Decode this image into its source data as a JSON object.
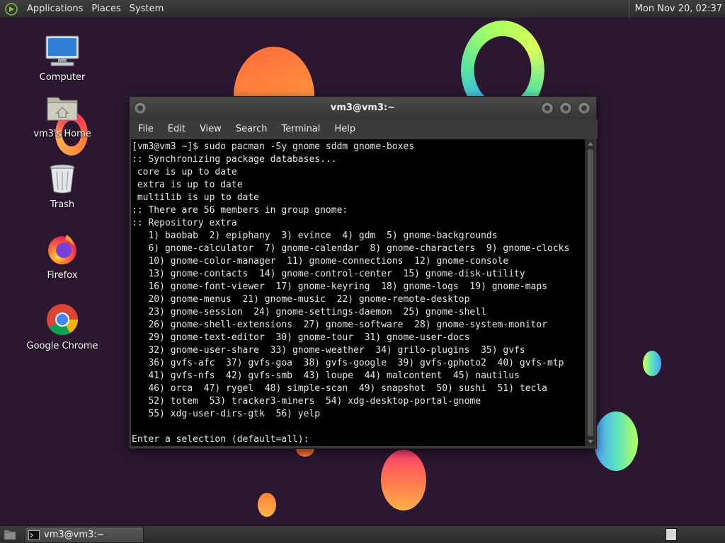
{
  "top_panel": {
    "menus": [
      "Applications",
      "Places",
      "System"
    ],
    "clock": "Mon Nov 20, 02:37"
  },
  "desktop_icons": [
    {
      "label": "Computer",
      "icon": "computer-icon"
    },
    {
      "label": "vm3's Home",
      "icon": "home-folder-icon"
    },
    {
      "label": "Trash",
      "icon": "trash-icon"
    },
    {
      "label": "Firefox",
      "icon": "firefox-icon"
    },
    {
      "label": "Google Chrome",
      "icon": "chrome-icon"
    }
  ],
  "terminal": {
    "title": "vm3@vm3:~",
    "menus": [
      "File",
      "Edit",
      "View",
      "Search",
      "Terminal",
      "Help"
    ],
    "lines": [
      "[vm3@vm3 ~]$ sudo pacman -Sy gnome sddm gnome-boxes",
      ":: Synchronizing package databases...",
      " core is up to date",
      " extra is up to date",
      " multilib is up to date",
      ":: There are 56 members in group gnome:",
      ":: Repository extra",
      "   1) baobab  2) epiphany  3) evince  4) gdm  5) gnome-backgrounds",
      "   6) gnome-calculator  7) gnome-calendar  8) gnome-characters  9) gnome-clocks",
      "   10) gnome-color-manager  11) gnome-connections  12) gnome-console",
      "   13) gnome-contacts  14) gnome-control-center  15) gnome-disk-utility",
      "   16) gnome-font-viewer  17) gnome-keyring  18) gnome-logs  19) gnome-maps",
      "   20) gnome-menus  21) gnome-music  22) gnome-remote-desktop",
      "   23) gnome-session  24) gnome-settings-daemon  25) gnome-shell",
      "   26) gnome-shell-extensions  27) gnome-software  28) gnome-system-monitor",
      "   29) gnome-text-editor  30) gnome-tour  31) gnome-user-docs",
      "   32) gnome-user-share  33) gnome-weather  34) grilo-plugins  35) gvfs",
      "   36) gvfs-afc  37) gvfs-goa  38) gvfs-google  39) gvfs-gphoto2  40) gvfs-mtp",
      "   41) gvfs-nfs  42) gvfs-smb  43) loupe  44) malcontent  45) nautilus",
      "   46) orca  47) rygel  48) simple-scan  49) snapshot  50) sushi  51) tecla",
      "   52) totem  53) tracker3-miners  54) xdg-desktop-portal-gnome",
      "   55) xdg-user-dirs-gtk  56) yelp",
      "",
      "Enter a selection (default=all): "
    ]
  },
  "taskbar": {
    "tasks": [
      {
        "label": "vm3@vm3:~"
      }
    ]
  }
}
